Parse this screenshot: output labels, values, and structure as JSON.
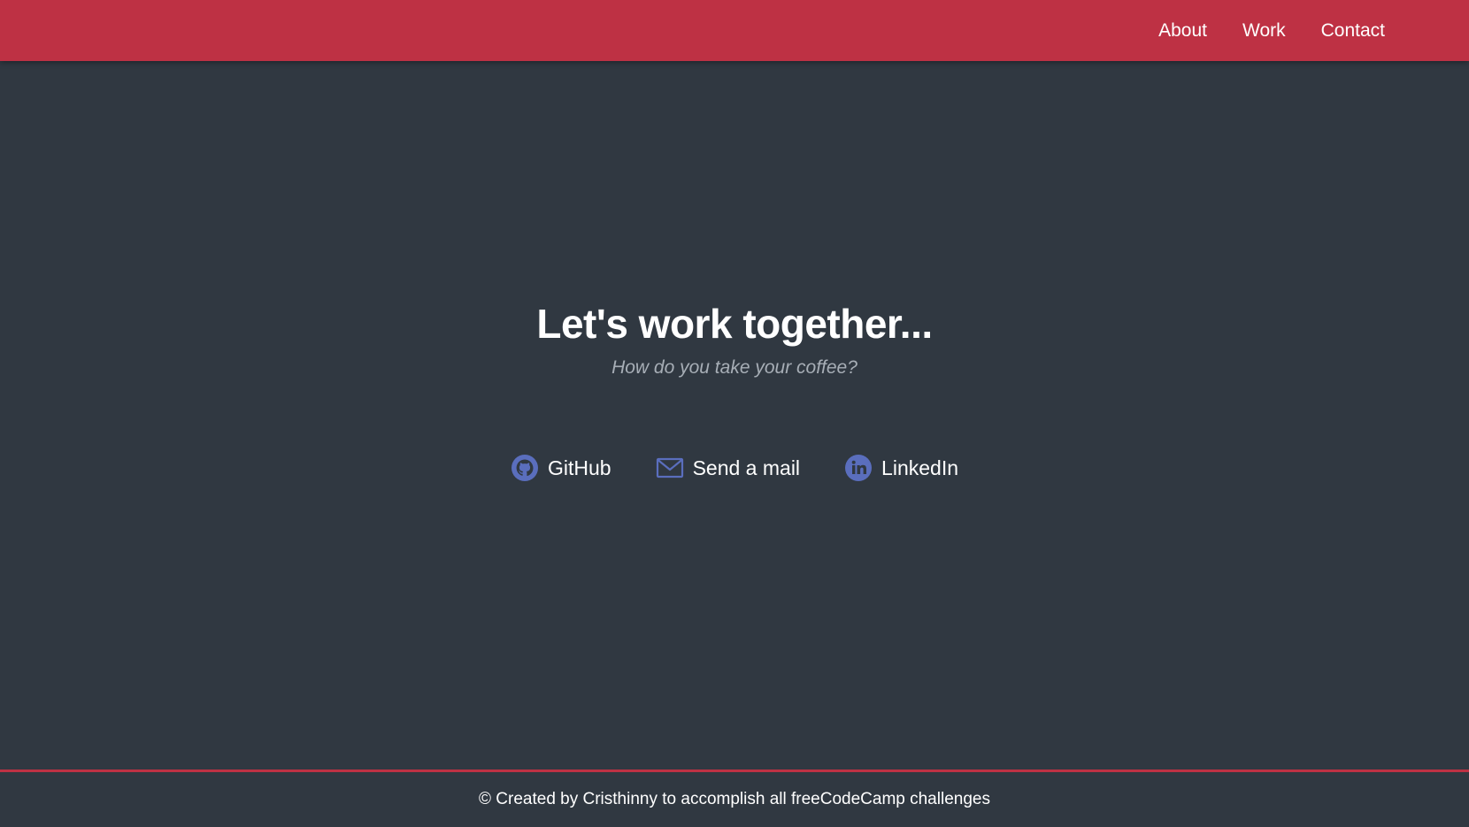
{
  "nav": {
    "links": [
      {
        "label": "About"
      },
      {
        "label": "Work"
      },
      {
        "label": "Contact"
      }
    ]
  },
  "hero": {
    "title": "Let's work together...",
    "subtitle": "How do you take your coffee?"
  },
  "contacts": [
    {
      "label": "GitHub",
      "icon": "github-icon"
    },
    {
      "label": "Send a mail",
      "icon": "mail-icon"
    },
    {
      "label": "LinkedIn",
      "icon": "linkedin-icon"
    }
  ],
  "footer": {
    "text": "© Created by Cristhinny to accomplish all freeCodeCamp challenges"
  },
  "colors": {
    "navbar": "#be3144",
    "background": "#303841",
    "icon": "#5a6ebd",
    "subtitle": "#a7aeb6"
  }
}
